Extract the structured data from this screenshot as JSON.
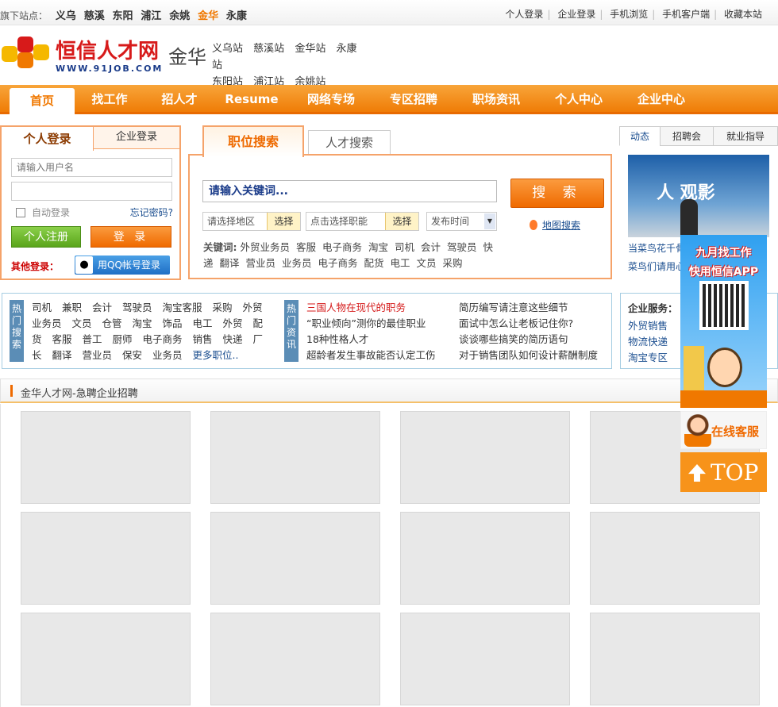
{
  "topbar": {
    "label": "旗下站点：",
    "sites": [
      "义乌",
      "慈溪",
      "东阳",
      "浦江",
      "余姚",
      "金华",
      "永康"
    ],
    "current_site": "金华",
    "links": [
      "个人登录",
      "企业登录",
      "手机浏览",
      "手机客户端",
      "收藏本站"
    ]
  },
  "header": {
    "brand": "恒信人才网",
    "url": "WWW.91JOB.COM",
    "city": "金华",
    "stations": [
      "义乌站",
      "慈溪站",
      "金华站",
      "永康站",
      "东阳站",
      "浦江站",
      "余姚站"
    ]
  },
  "nav": {
    "items": [
      "首页",
      "找工作",
      "招人才",
      "Resume",
      "网络专场",
      "专区招聘",
      "职场资讯",
      "个人中心",
      "企业中心"
    ],
    "active": "首页"
  },
  "login": {
    "tab_person": "个人登录",
    "tab_company": "企业登录",
    "username_placeholder": "请输入用户名",
    "password_placeholder": "",
    "auto_login": "自动登录",
    "forgot": "忘记密码?",
    "register": "个人注册",
    "submit": "登 录",
    "other_login": "其他登录：",
    "qq_login": "用QQ帐号登录"
  },
  "search": {
    "tab_job": "职位搜索",
    "tab_talent": "人才搜索",
    "keyword_placeholder": "请输入关键词...",
    "search_button": "搜 索",
    "area_placeholder": "请选择地区",
    "area_button": "选择",
    "job_placeholder": "点击选择职能",
    "job_button": "选择",
    "time_select": "发布时间",
    "map_search": "地图搜索",
    "hot_label": "关键词:",
    "hot_keywords": [
      "外贸业务员",
      "客服",
      "电子商务",
      "淘宝",
      "司机",
      "会计",
      "驾驶员",
      "快递",
      "翻译",
      "营业员",
      "业务员",
      "电子商务",
      "配货",
      "电工",
      "文员",
      "采购"
    ]
  },
  "news": {
    "tabs": [
      "动态",
      "招聘会",
      "就业指导"
    ],
    "photo_text": "人 观影",
    "lines": [
      "当菜鸟花千骨",
      "菜鸟们请用心"
    ]
  },
  "hot_jobs": {
    "label": "热门搜索",
    "items": [
      "司机",
      "兼职",
      "会计",
      "驾驶员",
      "淘宝客服",
      "采购",
      "外贸",
      "业务员",
      "文员",
      "仓管",
      "淘宝",
      "饰品",
      "电工",
      "外贸",
      "配",
      "货",
      "客服",
      "普工",
      "厨师",
      "电子商务",
      "销售",
      "快递",
      "厂",
      "长",
      "翻译",
      "营业员",
      "保安",
      "业务员"
    ],
    "more": "更多职位.."
  },
  "hot_info": {
    "label": "热门资讯",
    "col1": [
      "三国人物在现代的职务",
      "“职业倾向”测你的最佳职业",
      "18种性格人才",
      "超龄者发生事故能否认定工伤"
    ],
    "col2": [
      "简历编写请注意这些细节",
      "面试中怎么让老板记住你?",
      "谈谈哪些搞笑的简历语句",
      "对于销售团队如何设计薪酬制度"
    ]
  },
  "services": {
    "title": "企业服务：",
    "items": [
      "外贸销售",
      "物流快递",
      "淘宝专区"
    ]
  },
  "urgent": {
    "site": "金华人才网",
    "title": "-急聘企业招聘"
  },
  "float": {
    "app_line1": "九月找工作",
    "app_line2": "快用恒信APP",
    "service": "在线客服",
    "top": "TOP"
  }
}
